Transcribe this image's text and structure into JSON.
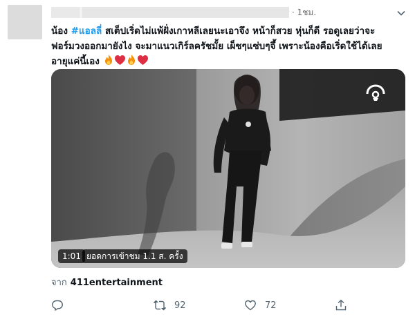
{
  "tweet": {
    "time": "· 1ชม.",
    "text": {
      "line1_prefix": "น้อง ",
      "hashtag": "#แอลลี่",
      "line1_rest": " สเต็ปเริ่ดไม่แพ้ฝั่งเกาหลีเลยนะเอาจึง หน้าก็สวย หุ่นก็ดี รอดูเลยว่าจะ",
      "line2": "ฟอร์มวงออกมายังไง จะมาแนวเกิร์ลครัชมั้ย เผ็ชๆแซ่บๆจึ้ เพราะน้องคือเริ่ดใช้ได้เลย",
      "line3": "อายุแค่นี้เอง",
      "emojis": [
        "fire",
        "red-heart",
        "fire",
        "red-heart"
      ]
    },
    "media": {
      "duration": "1:01",
      "views": "ยอดการเข้าชม 1.1 ส. ครั้ง"
    },
    "source": {
      "from_label": "จาก",
      "name": "411entertainment"
    },
    "actions": {
      "reply_icon": "reply-icon",
      "retweet_count": "92",
      "like_count": "72",
      "share_icon": "share-icon"
    },
    "colors": {
      "hashtag": "#1d9bf0",
      "text": "#0f1419",
      "muted": "#536471"
    }
  }
}
